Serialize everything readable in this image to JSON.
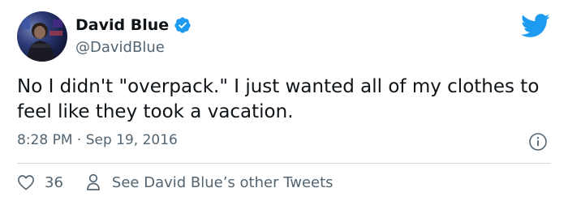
{
  "author": {
    "name": "David Blue",
    "handle": "@DavidBlue",
    "verified": true
  },
  "tweet": {
    "text": "No I didn't \"overpack.\" I just wanted all of my clothes to feel like they took a vacation.",
    "timestamp": "8:28 PM · Sep 19, 2016"
  },
  "actions": {
    "like_count": "36",
    "other_tweets_label": "See David Blue’s other Tweets"
  },
  "colors": {
    "twitter_blue": "#1d9bf0",
    "text_primary": "#0f1419",
    "text_secondary": "#536471",
    "divider": "#cfd9de"
  },
  "icons": [
    "avatar-image",
    "verified-badge-icon",
    "twitter-bird-icon",
    "info-icon",
    "heart-icon",
    "person-icon"
  ]
}
